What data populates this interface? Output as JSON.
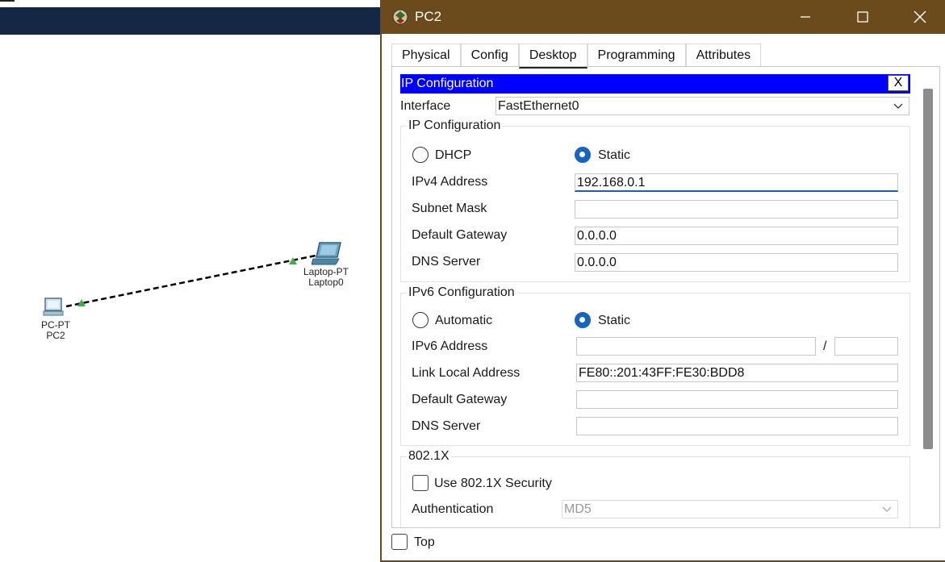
{
  "workspace": {
    "devices": [
      {
        "type_label": "PC-PT",
        "name": "PC2"
      },
      {
        "type_label": "Laptop-PT",
        "name": "Laptop0"
      }
    ]
  },
  "window": {
    "title": "PC2",
    "tabs": [
      {
        "label": "Physical",
        "active": false
      },
      {
        "label": "Config",
        "active": false
      },
      {
        "label": "Desktop",
        "active": true
      },
      {
        "label": "Programming",
        "active": false
      },
      {
        "label": "Attributes",
        "active": false
      }
    ],
    "ip_config": {
      "title": "IP Configuration",
      "close_label": "X",
      "interface_label": "Interface",
      "interface_value": "FastEthernet0",
      "ipv4_group": {
        "title": "IP Configuration",
        "dhcp_label": "DHCP",
        "static_label": "Static",
        "selected": "Static",
        "ipv4_address_label": "IPv4 Address",
        "ipv4_address_value": "192.168.0.1",
        "subnet_mask_label": "Subnet Mask",
        "subnet_mask_value": "",
        "default_gateway_label": "Default Gateway",
        "default_gateway_value": "0.0.0.0",
        "dns_server_label": "DNS Server",
        "dns_server_value": "0.0.0.0"
      },
      "ipv6_group": {
        "title": "IPv6 Configuration",
        "automatic_label": "Automatic",
        "static_label": "Static",
        "selected": "Static",
        "ipv6_address_label": "IPv6 Address",
        "ipv6_address_value": "",
        "prefix_separator": "/",
        "prefix_value": "",
        "link_local_label": "Link Local Address",
        "link_local_value": "FE80::201:43FF:FE30:BDD8",
        "default_gateway_label": "Default Gateway",
        "default_gateway_value": "",
        "dns_server_label": "DNS Server",
        "dns_server_value": ""
      },
      "dot1x_group": {
        "title": "802.1X",
        "use_security_label": "Use 802.1X Security",
        "use_security_checked": false,
        "authentication_label": "Authentication",
        "authentication_value": "MD5"
      }
    },
    "top_checkbox_label": "Top",
    "top_checked": false
  },
  "colors": {
    "titlebar": "#6b4a1c",
    "workspace_bar": "#142845",
    "ipcfg_bar": "#0000ff",
    "radio_selected": "#1565c0",
    "link_line": "#000000",
    "link_endpoint": "#3cb043"
  },
  "icons": {
    "window_icon": "packet-tracer-icon",
    "minimize": "minimize-icon",
    "maximize": "maximize-icon",
    "close": "close-icon",
    "dropdown": "chevron-down-icon"
  }
}
